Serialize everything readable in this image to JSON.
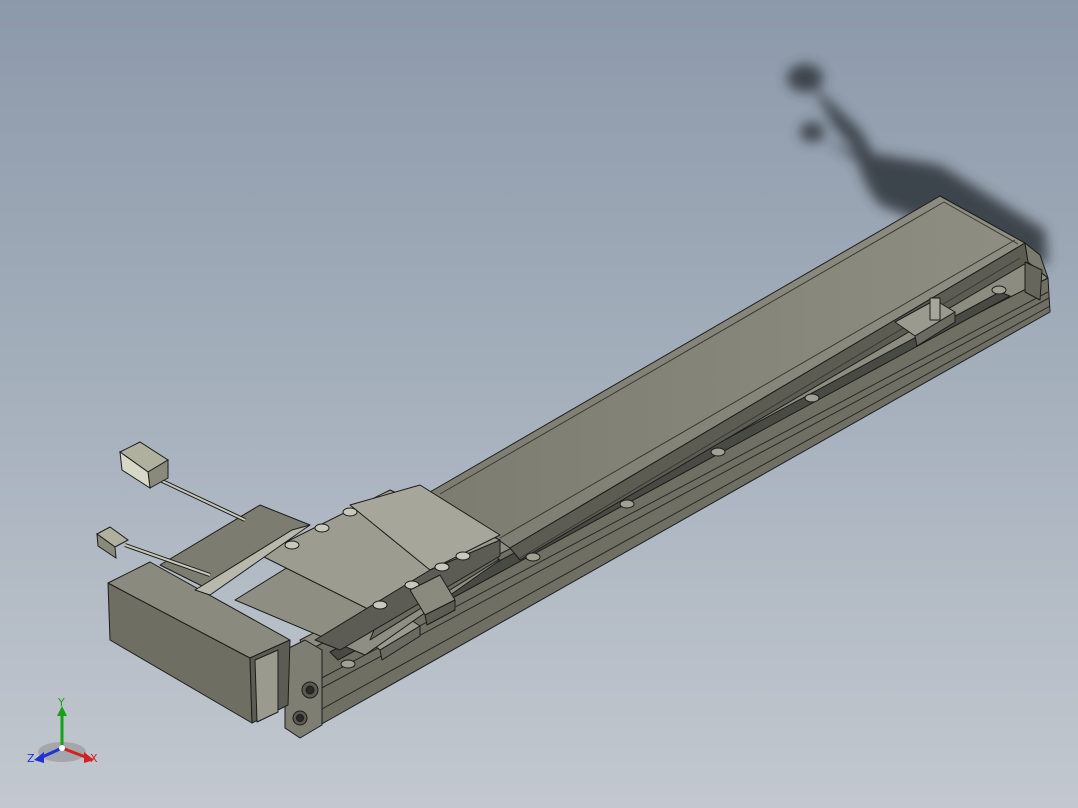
{
  "viewport": {
    "background_top": "#8c99aa",
    "background_bottom": "#c3c8cf"
  },
  "model": {
    "body_color": "#8a8a7c",
    "body_dark": "#5f5f56",
    "body_light": "#a4a496",
    "edge_color": "#1c1c1c",
    "shadow_color": "#2f343b"
  },
  "triad": {
    "x_label": "X",
    "y_label": "Y",
    "z_label": "Z",
    "x_color": "#d42020",
    "y_color": "#18a018",
    "z_color": "#2030d8",
    "icons": [
      "view-triad-icon"
    ]
  }
}
